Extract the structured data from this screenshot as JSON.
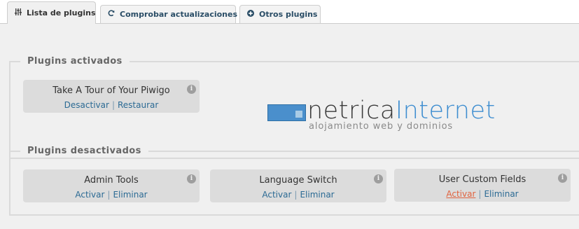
{
  "tabs": [
    {
      "label": "Lista de plugins",
      "icon": "sliders-icon",
      "active": true
    },
    {
      "label": "Comprobar actualizaciones",
      "icon": "refresh-icon",
      "active": false
    },
    {
      "label": "Otros plugins",
      "icon": "plus-circle-icon",
      "active": false
    }
  ],
  "activated": {
    "legend": "Plugins activados",
    "plugins": [
      {
        "name": "Take A Tour of Your Piwigo",
        "action1": "Desactivar",
        "action2": "Restaurar"
      }
    ]
  },
  "deactivated": {
    "legend": "Plugins desactivados",
    "plugins": [
      {
        "name": "Admin Tools",
        "action1": "Activar",
        "action2": "Eliminar"
      },
      {
        "name": "Language Switch",
        "action1": "Activar",
        "action2": "Eliminar"
      },
      {
        "name": "User Custom Fields",
        "action1": "Activar",
        "action2": "Eliminar"
      }
    ]
  },
  "separator": "|",
  "info_glyph": "i",
  "logo": {
    "brand_part1": "netrica",
    "brand_part2": "Internet",
    "tagline": "alojamiento web y dominios"
  },
  "colors": {
    "link": "#2b6a94",
    "link_hover": "#e0623e",
    "brand_blue": "#3f8ed0"
  }
}
